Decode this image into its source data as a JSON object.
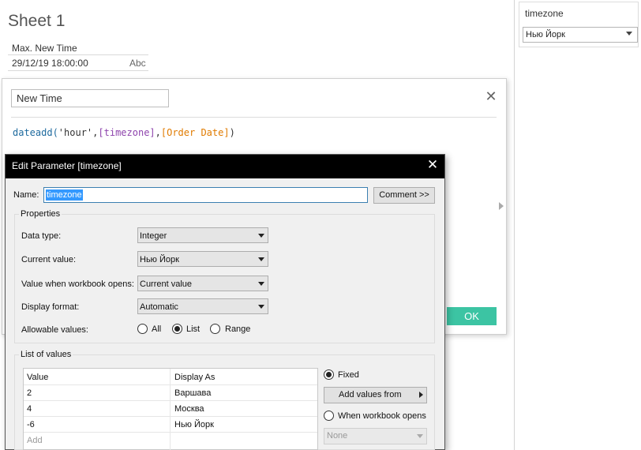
{
  "sheet": {
    "title": "Sheet 1",
    "column_header": "Max. New Time",
    "cell_value": "29/12/19 18:00:00",
    "cell_type": "Abc"
  },
  "parameter_control": {
    "label": "timezone",
    "selected": "Нью Йорк"
  },
  "calc_editor": {
    "name": "New Time",
    "formula": {
      "fn": "dateadd(",
      "arg1": "'hour'",
      "comma1": ",",
      "arg2": "[timezone]",
      "comma2": ",",
      "arg3": "[Order Date]",
      "close": ")"
    },
    "ok_label": "OK"
  },
  "edit_parameter": {
    "title": "Edit Parameter [timezone]",
    "name_label": "Name:",
    "name_value": "timezone",
    "comment_button": "Comment >>",
    "properties": {
      "title": "Properties",
      "data_type_label": "Data type:",
      "data_type_value": "Integer",
      "current_value_label": "Current value:",
      "current_value_value": "Нью Йорк",
      "workbook_opens_label": "Value when workbook opens:",
      "workbook_opens_value": "Current value",
      "display_format_label": "Display format:",
      "display_format_value": "Automatic",
      "allowable_label": "Allowable values:",
      "allowable_options": [
        "All",
        "List",
        "Range"
      ],
      "allowable_selected": "List"
    },
    "list_of_values": {
      "title": "List of values",
      "columns": [
        "Value",
        "Display As"
      ],
      "rows": [
        [
          "2",
          "Варшава"
        ],
        [
          "4",
          "Москва"
        ],
        [
          "-6",
          "Нью Йорк"
        ]
      ],
      "add_placeholder": "Add",
      "fixed_label": "Fixed",
      "add_values_from_label": "Add values from",
      "when_workbook_opens_label": "When workbook opens",
      "none_option": "None",
      "source_selected": "Fixed"
    }
  }
}
